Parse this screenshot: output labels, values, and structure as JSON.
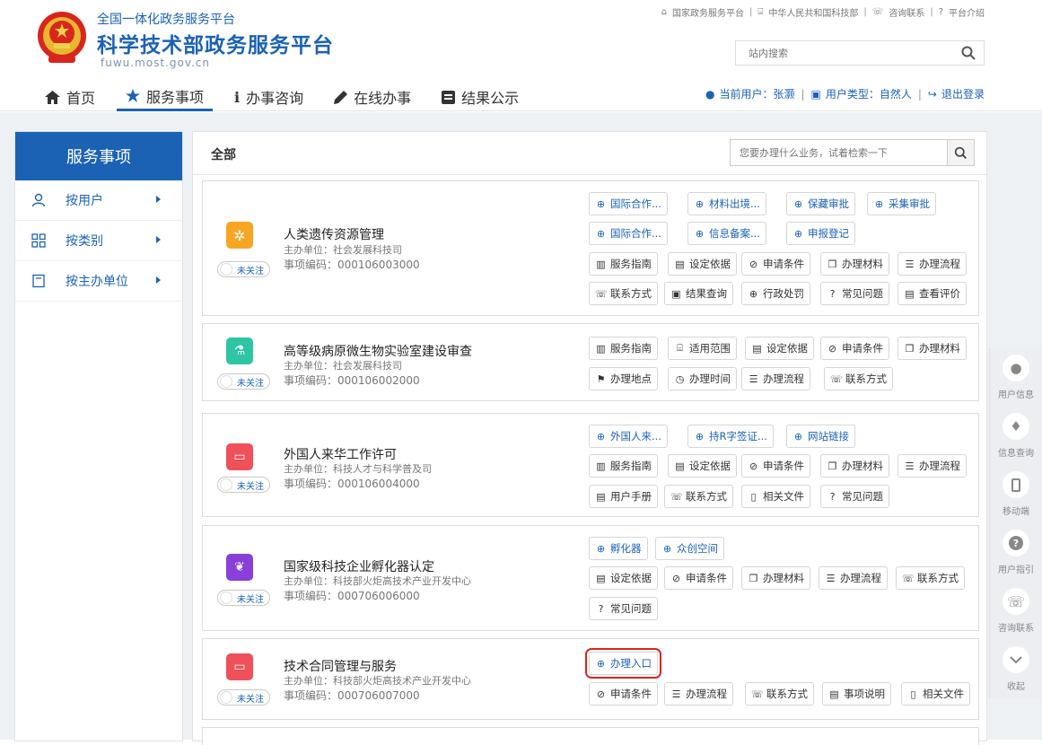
{
  "header": {
    "brand_top": "全国一体化政务服务平台",
    "brand_main": "科学技术部政务服务平台",
    "brand_url": "fuwu.most.gov.cn",
    "top_links": [
      "国家政务服务平台",
      "中华人民共和国科技部",
      "咨询联系",
      "平台介绍"
    ],
    "search_placeholder": "站内搜索",
    "nav": [
      "首页",
      "服务事项",
      "办事咨询",
      "在线办事",
      "结果公示"
    ],
    "user_label": "当前用户：张灏",
    "usertype_label": "用户类型：自然人",
    "logout_label": "退出登录"
  },
  "sidebar": {
    "title": "服务事项",
    "items": [
      "按用户",
      "按类别",
      "按主办单位"
    ]
  },
  "main": {
    "title": "全部",
    "search_placeholder": "您要办理什么业务，试着检索一下",
    "follow_label": "未关注"
  },
  "cards": [
    {
      "name": "人类遗传资源管理",
      "unit": "主办单位：社会发展科技司",
      "code": "事项编码：000106003000",
      "color": "#f6a623",
      "links": [
        "国际合作...",
        "材料出境...",
        "保藏审批",
        "采集审批",
        "国际合作...",
        "信息备案...",
        "申报登记"
      ],
      "buttons": [
        "服务指南",
        "设定依据",
        "申请条件",
        "办理材料",
        "办理流程",
        "联系方式",
        "结果查询",
        "行政处罚",
        "常见问题",
        "查看评价"
      ]
    },
    {
      "name": "高等级病原微生物实验室建设审查",
      "unit": "主办单位：社会发展科技司",
      "code": "事项编码：000106002000",
      "color": "#2ec5a4",
      "links": [],
      "buttons": [
        "服务指南",
        "适用范围",
        "设定依据",
        "申请条件",
        "办理材料",
        "办理地点",
        "办理时间",
        "办理流程",
        "联系方式"
      ]
    },
    {
      "name": "外国人来华工作许可",
      "unit": "主办单位：科技人才与科学普及司",
      "code": "事项编码：000106004000",
      "color": "#ef5059",
      "links": [
        "外国人来...",
        "持R字签证...",
        "网站链接"
      ],
      "buttons": [
        "服务指南",
        "设定依据",
        "申请条件",
        "办理材料",
        "办理流程",
        "用户手册",
        "联系方式",
        "相关文件",
        "常见问题"
      ]
    },
    {
      "name": "国家级科技企业孵化器认定",
      "unit": "主办单位：科技部火炬高技术产业开发中心",
      "code": "事项编码：000706006000",
      "color": "#8b3fd9",
      "links": [
        "孵化器",
        "众创空间"
      ],
      "buttons": [
        "设定依据",
        "申请条件",
        "办理材料",
        "办理流程",
        "联系方式",
        "常见问题"
      ]
    },
    {
      "name": "技术合同管理与服务",
      "unit": "主办单位：科技部火炬高技术产业开发中心",
      "code": "事项编码：000706007000",
      "color": "#ef5059",
      "links": [
        "办理入口"
      ],
      "buttons": [
        "申请条件",
        "办理流程",
        "联系方式",
        "事项说明",
        "相关文件"
      ]
    }
  ],
  "right_toolbar": [
    "用户信息",
    "信息查询",
    "移动端",
    "用户指引",
    "咨询联系",
    "收起"
  ]
}
